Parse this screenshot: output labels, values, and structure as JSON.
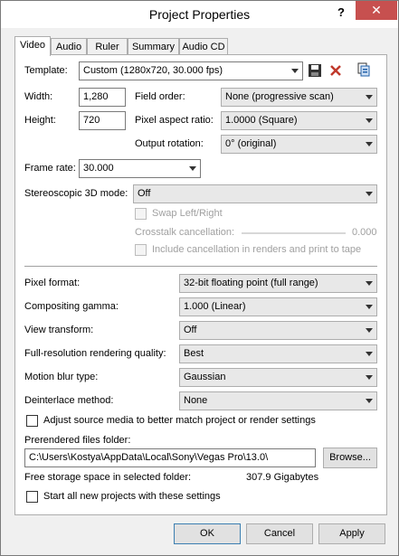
{
  "window": {
    "title": "Project Properties",
    "help": "?",
    "close": "✕"
  },
  "tabs": [
    "Video",
    "Audio",
    "Ruler",
    "Summary",
    "Audio CD"
  ],
  "template": {
    "label": "Template:",
    "value": "Custom (1280x720, 30.000 fps)"
  },
  "width": {
    "label": "Width:",
    "value": "1,280"
  },
  "height": {
    "label": "Height:",
    "value": "720"
  },
  "field_order": {
    "label": "Field order:",
    "value": "None (progressive scan)"
  },
  "pixel_aspect": {
    "label": "Pixel aspect ratio:",
    "value": "1.0000 (Square)"
  },
  "output_rotation": {
    "label": "Output rotation:",
    "value": "0° (original)"
  },
  "frame_rate": {
    "label": "Frame rate:",
    "value": "30.000"
  },
  "stereo": {
    "label": "Stereoscopic 3D mode:",
    "value": "Off"
  },
  "swap": {
    "label": "Swap Left/Right"
  },
  "crosstalk": {
    "label": "Crosstalk cancellation:",
    "value": "0.000"
  },
  "include_cancel": {
    "label": "Include cancellation in renders and print to tape"
  },
  "pixel_format": {
    "label": "Pixel format:",
    "value": "32-bit floating point (full range)"
  },
  "compositing_gamma": {
    "label": "Compositing gamma:",
    "value": "1.000 (Linear)"
  },
  "view_transform": {
    "label": "View transform:",
    "value": "Off"
  },
  "render_quality": {
    "label": "Full-resolution rendering quality:",
    "value": "Best"
  },
  "motion_blur": {
    "label": "Motion blur type:",
    "value": "Gaussian"
  },
  "deinterlace": {
    "label": "Deinterlace method:",
    "value": "None"
  },
  "adjust_media": {
    "label": "Adjust source media to better match project or render settings"
  },
  "prerendered": {
    "label": "Prerendered files folder:",
    "value": "C:\\Users\\Kostya\\AppData\\Local\\Sony\\Vegas Pro\\13.0\\",
    "browse": "Browse..."
  },
  "storage": {
    "label": "Free storage space in selected folder:",
    "value": "307.9 Gigabytes"
  },
  "start_new": {
    "label": "Start all new projects with these settings"
  },
  "buttons": {
    "ok": "OK",
    "cancel": "Cancel",
    "apply": "Apply"
  },
  "colors": {
    "close_bg": "#c7504f",
    "delete_icon": "#c0392b",
    "default_border": "#3c7fb1"
  }
}
